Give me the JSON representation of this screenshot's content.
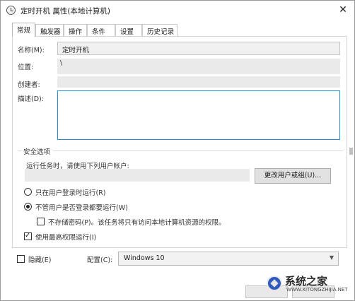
{
  "window": {
    "title": "定时开机 属性(本地计算机)",
    "close_glyph": "✕"
  },
  "tabs": [
    {
      "label": "常规",
      "active": true
    },
    {
      "label": "触发器"
    },
    {
      "label": "操作"
    },
    {
      "label": "条件"
    },
    {
      "label": "设置"
    },
    {
      "label": "历史记录"
    }
  ],
  "general": {
    "name_label": "名称(M):",
    "name_value": "定时开机",
    "location_label": "位置:",
    "location_value": "\\",
    "author_label": "创建者:",
    "description_label": "描述(D):"
  },
  "security": {
    "group_label": "安全选项",
    "run_as_label": "运行任务时，请使用下列用户帐户:",
    "change_user_button": "更改用户或组(U)...",
    "radio_logged_on": "只在用户登录时运行(R)",
    "radio_whether_logged": "不管用户是否登录都要运行(W)",
    "no_store_password": "不存储密码(P)。该任务将只有访问本地计算机资源的权限。",
    "highest_privileges": "使用最高权限运行(I)"
  },
  "bottom": {
    "hidden_label": "隐藏(E)",
    "configure_label": "配置(C):",
    "configure_value": "Windows 10"
  },
  "watermark": {
    "brand": "系统之家",
    "url": "WWW.XITONGZHIJIA.NET"
  }
}
